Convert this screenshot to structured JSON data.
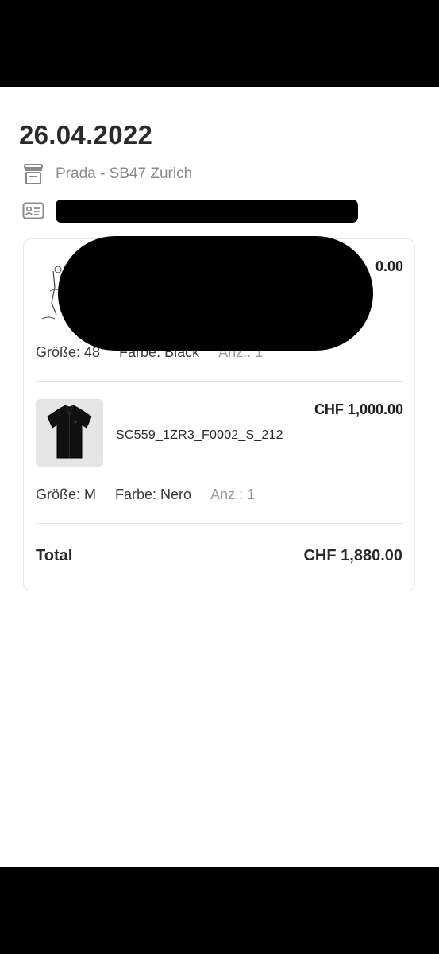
{
  "header": {
    "date": "26.04.2022",
    "store": "Prada - SB47 Zurich",
    "store_icon": "store-icon",
    "id_icon": "id-card-icon"
  },
  "items": [
    {
      "price": "CHF 880.00",
      "price_visible": "0.00",
      "size": "Größe: 48",
      "color": "Farbe: Black",
      "qty": "Anz.: 1",
      "thumb_icon": "sketch-figure-image"
    },
    {
      "price": "CHF 1,000.00",
      "sku": "SC559_1ZR3_F0002_S_212",
      "size": "Größe: M",
      "color": "Farbe: Nero",
      "qty": "Anz.: 1",
      "thumb_icon": "black-shirt-image"
    }
  ],
  "total": {
    "label": "Total",
    "value": "CHF 1,880.00"
  },
  "colors": {
    "text": "#1d1d1f",
    "muted": "#8a8a8e",
    "border": "#e6e6e8",
    "redaction": "#000000"
  }
}
